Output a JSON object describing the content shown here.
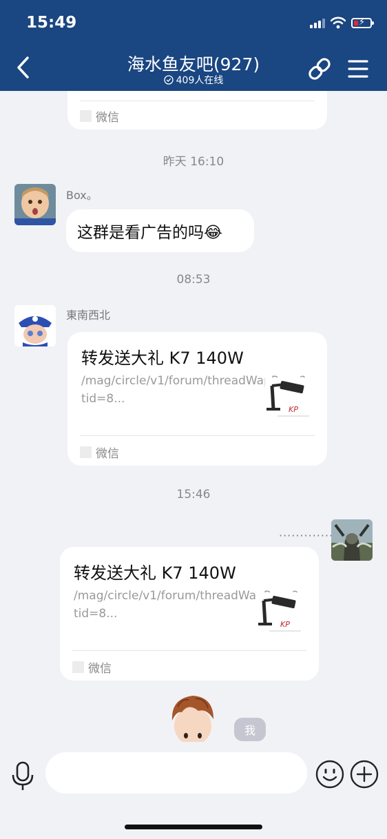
{
  "status": {
    "time": "15:49"
  },
  "header": {
    "title": "海水鱼友吧(927)",
    "online": "409人在线"
  },
  "chat": {
    "top_card_source": "微信",
    "time_1": "昨天 16:10",
    "msg1": {
      "sender": "Box。",
      "text": "这群是看广告的吗😂"
    },
    "time_2": "08:53",
    "msg2": {
      "sender": "東南西北",
      "title": "转发送大礼 K7 140W",
      "url": "/mag/circle/v1/forum/threadWapPage?tid=8...",
      "source": "微信"
    },
    "time_3": "15:46",
    "msg3": {
      "sender": "··············",
      "title": "转发送大礼 K7 140W",
      "url": "/mag/circle/v1/forum/threadWapPage?tid=8...",
      "source": "微信"
    },
    "me_tag": "我"
  },
  "input": {
    "placeholder": ""
  },
  "colors": {
    "header_bg": "#1a4681",
    "chat_bg": "#f1f2f6",
    "battery_low": "#e0283a"
  },
  "icons": [
    "back-arrow-icon",
    "share-link-icon",
    "menu-icon",
    "mic-icon",
    "emoji-icon",
    "plus-icon"
  ]
}
